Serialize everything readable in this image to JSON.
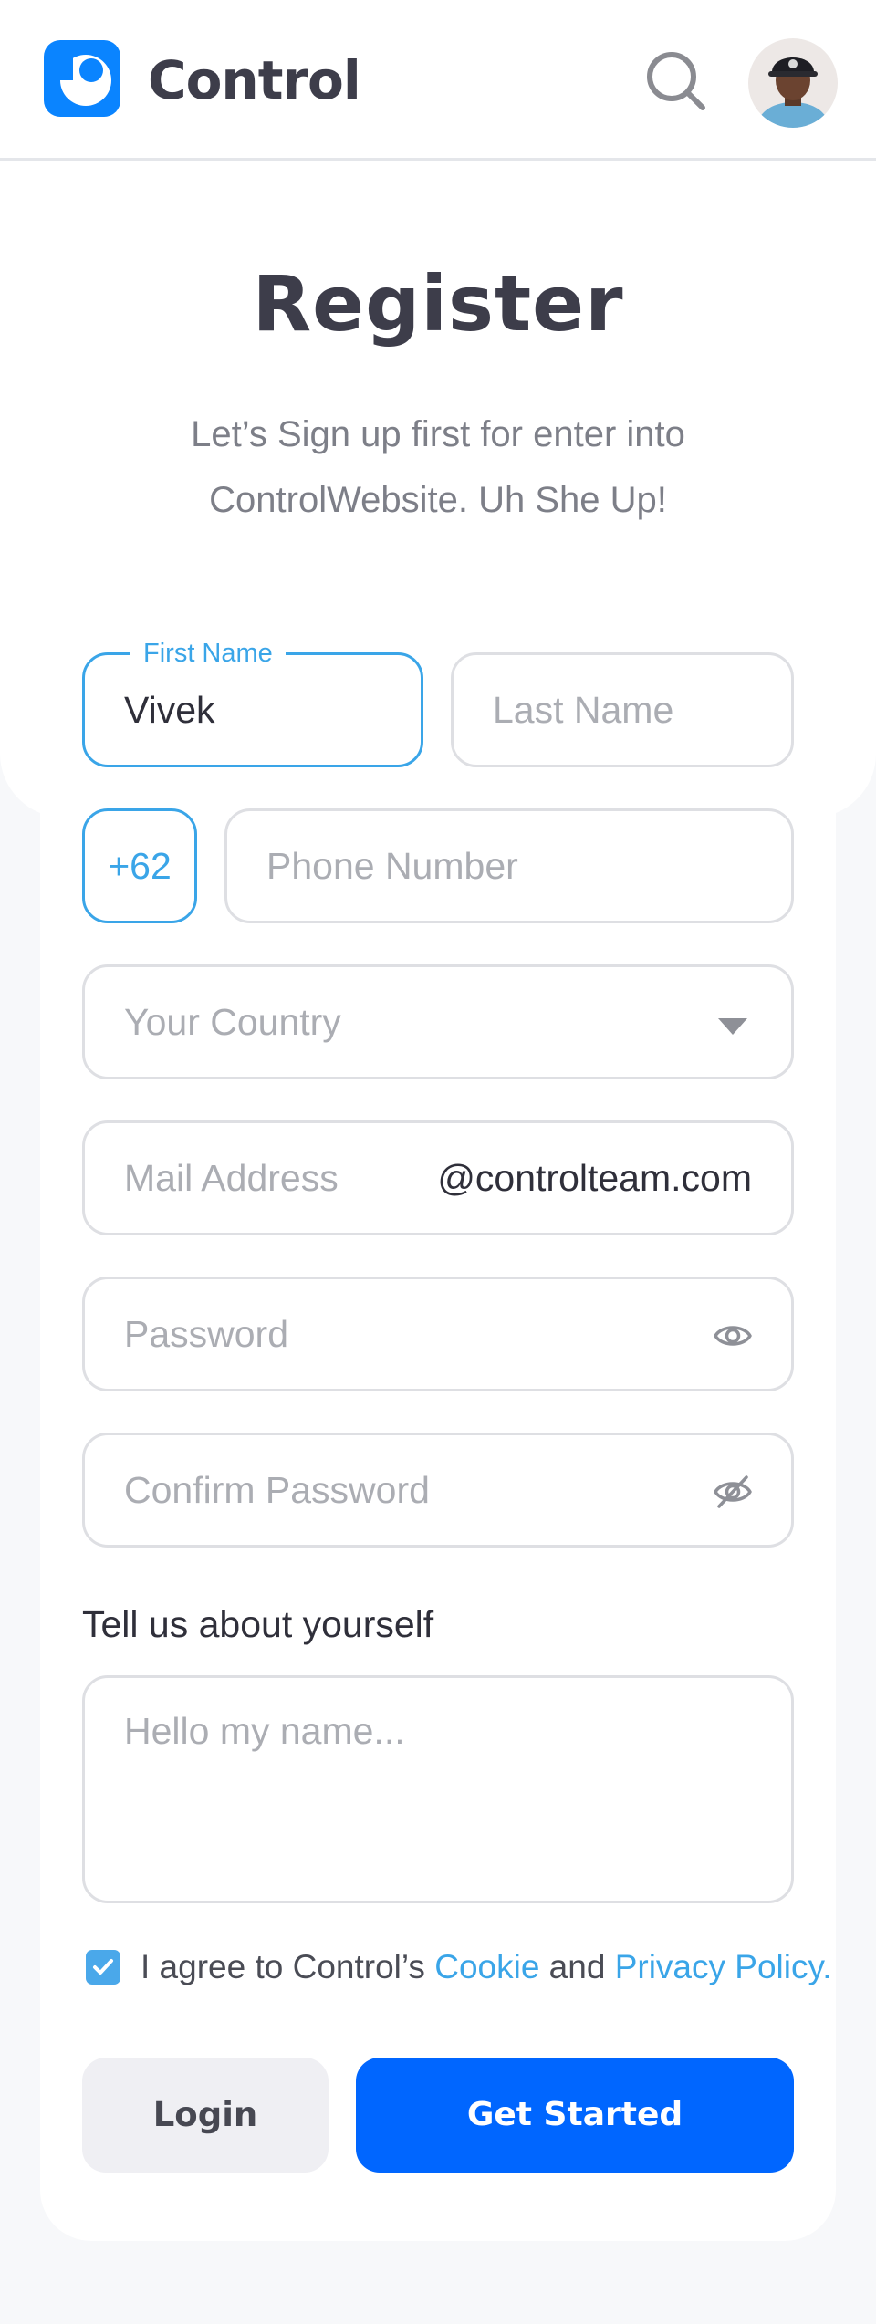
{
  "header": {
    "brand": "Control",
    "brand_color": "#0a84ff"
  },
  "page": {
    "title": "Register",
    "subtitle": "Let’s Sign up first for enter into ControlWebsite. Uh She Up!"
  },
  "form": {
    "first_name": {
      "label": "First Name",
      "value": "Vivek"
    },
    "last_name": {
      "placeholder": "Last Name"
    },
    "phone": {
      "prefix": "+62",
      "placeholder": "Phone Number"
    },
    "country": {
      "placeholder": "Your Country"
    },
    "email": {
      "placeholder": "Mail Address",
      "suffix": "@controlteam.com"
    },
    "password": {
      "placeholder": "Password"
    },
    "confirm_password": {
      "placeholder": "Confirm Password"
    },
    "about": {
      "label": "Tell us about yourself",
      "placeholder": "Hello my name..."
    },
    "agree": {
      "checked": true,
      "text_before": "I agree to Control’s ",
      "cookie_link": "Cookie",
      "text_middle": " and ",
      "privacy_link": "Privacy Policy."
    },
    "buttons": {
      "login": "Login",
      "get_started": "Get Started"
    }
  },
  "colors": {
    "accent": "#3aa5e8",
    "primary_button": "#0066ff",
    "text_dark": "#3d3d4a"
  }
}
